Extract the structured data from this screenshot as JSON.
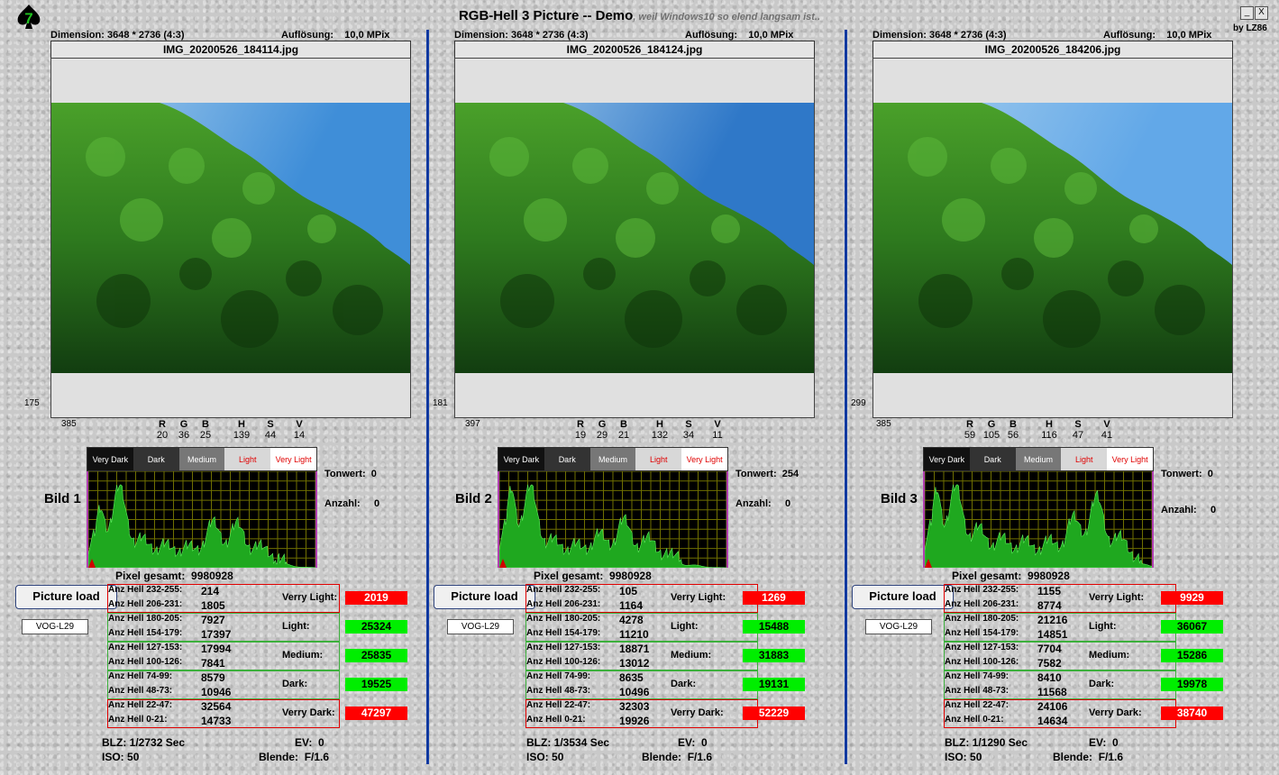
{
  "header": {
    "title": "RGB-Hell 3 Picture -- Demo",
    "subtitle": ", weil Windows10 so elend langsam ist..",
    "minimize": "_",
    "close": "X",
    "author": "by LZ86",
    "logo_icon": "spade-seven-icon"
  },
  "hist_head": {
    "very_dark": "Very Dark",
    "dark": "Dark",
    "medium": "Medium",
    "light": "Light",
    "very_light": "Very Light"
  },
  "labels": {
    "dimension": "Dimension:",
    "resolution": "Auflösung:",
    "r": "R",
    "g": "G",
    "b": "B",
    "h": "H",
    "s": "S",
    "v": "V",
    "tonwert": "Tonwert:",
    "anzahl": "Anzahl:",
    "pixel_total": "Pixel gesamt:",
    "load": "Picture load",
    "very_light": "Verry Light:",
    "light": "Light:",
    "medium": "Medium:",
    "dark": "Dark:",
    "very_dark": "Verry Dark:",
    "blz": "BLZ:",
    "ev": "EV:",
    "iso": "ISO:",
    "blende": "Blende:",
    "ranges": [
      "Anz Hell 232-255:",
      "Anz Hell 206-231:",
      "Anz Hell 180-205:",
      "Anz Hell 154-179:",
      "Anz Hell 127-153:",
      "Anz Hell 100-126:",
      "Anz Hell 74-99:",
      "Anz Hell 48-73:",
      "Anz Hell 22-47:",
      "Anz Hell 0-21:"
    ]
  },
  "panels": [
    {
      "dimension": "3648 * 2736 (4:3)",
      "resolution": "10,0 MPix",
      "filename": "IMG_20200526_184114.jpg",
      "coord_y": "175",
      "coord_x": "385",
      "rgb": {
        "r": "20",
        "g": "36",
        "b": "25"
      },
      "hsv": {
        "h": "139",
        "s": "44",
        "v": "14"
      },
      "bild": "Bild 1",
      "tonwert": "0",
      "anzahl": "0",
      "pixel_total": "9980928",
      "device": "VOG-L29",
      "counts": [
        "214",
        "1805",
        "7927",
        "17397",
        "17994",
        "7841",
        "8579",
        "10946",
        "32564",
        "14733"
      ],
      "sums": {
        "very_light": "2019",
        "light": "25324",
        "medium": "25835",
        "dark": "19525",
        "very_dark": "47297"
      },
      "exif": {
        "blz": "1/2732 Sec",
        "ev": "0",
        "iso": "50",
        "blende": "F/1.6"
      },
      "photo_sky": "#3f8ed8"
    },
    {
      "dimension": "3648 * 2736 (4:3)",
      "resolution": "10,0 MPix",
      "filename": "IMG_20200526_184124.jpg",
      "coord_y": "181",
      "coord_x": "397",
      "rgb": {
        "r": "19",
        "g": "29",
        "b": "21"
      },
      "hsv": {
        "h": "132",
        "s": "34",
        "v": "11"
      },
      "bild": "Bild 2",
      "tonwert": "254",
      "anzahl": "0",
      "pixel_total": "9980928",
      "device": "VOG-L29",
      "counts": [
        "105",
        "1164",
        "4278",
        "11210",
        "18871",
        "13012",
        "8635",
        "10496",
        "32303",
        "19926"
      ],
      "sums": {
        "very_light": "1269",
        "light": "15488",
        "medium": "31883",
        "dark": "19131",
        "very_dark": "52229"
      },
      "exif": {
        "blz": "1/3534 Sec",
        "ev": "0",
        "iso": "50",
        "blende": "F/1.6"
      },
      "photo_sky": "#2f78c8"
    },
    {
      "dimension": "3648 * 2736 (4:3)",
      "resolution": "10,0 MPix",
      "filename": "IMG_20200526_184206.jpg",
      "coord_y": "299",
      "coord_x": "385",
      "rgb": {
        "r": "59",
        "g": "105",
        "b": "56"
      },
      "hsv": {
        "h": "116",
        "s": "47",
        "v": "41"
      },
      "bild": "Bild 3",
      "tonwert": "0",
      "anzahl": "0",
      "pixel_total": "9980928",
      "device": "VOG-L29",
      "counts": [
        "1155",
        "8774",
        "21216",
        "14851",
        "7704",
        "7582",
        "8410",
        "11568",
        "24106",
        "14634"
      ],
      "sums": {
        "very_light": "9929",
        "light": "36067",
        "medium": "15286",
        "dark": "19978",
        "very_dark": "38740"
      },
      "exif": {
        "blz": "1/1290 Sec",
        "ev": "0",
        "iso": "50",
        "blende": "F/1.6"
      },
      "photo_sky": "#62a8e8"
    }
  ]
}
